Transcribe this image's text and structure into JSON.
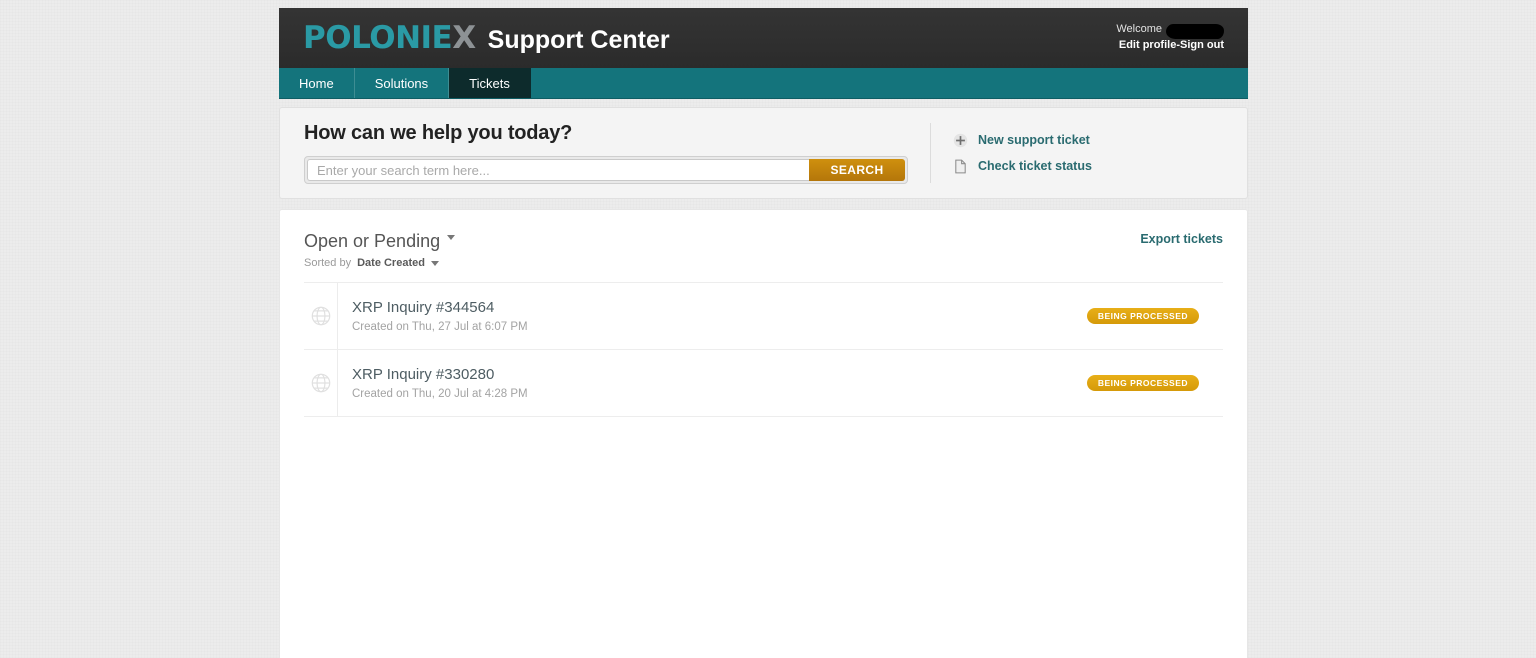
{
  "header": {
    "logo_main": "POLONIE",
    "logo_x": "X",
    "site_title": "Support Center",
    "welcome_label": "Welcome",
    "edit_profile": "Edit profile",
    "separator": "-",
    "sign_out": "Sign out",
    "brand_color": "#2a9aa5",
    "logo_x_color": "#8d9295",
    "bar_color": "#2e2e2e"
  },
  "nav": {
    "items": [
      {
        "label": "Home",
        "active": false
      },
      {
        "label": "Solutions",
        "active": false
      },
      {
        "label": "Tickets",
        "active": true
      }
    ],
    "bar_color": "#14747c",
    "active_color": "#0d2b2c"
  },
  "search": {
    "heading": "How can we help you today?",
    "placeholder": "Enter your search term here...",
    "value": "",
    "button_label": "SEARCH",
    "button_color": "#c2830c"
  },
  "quick_links": [
    {
      "label": "New support ticket",
      "icon": "plus-circle-icon"
    },
    {
      "label": "Check ticket status",
      "icon": "document-icon"
    }
  ],
  "ticket_list": {
    "filter_label": "Open or Pending",
    "sorted_by_prefix": "Sorted by",
    "sorted_by_value": "Date Created",
    "export_label": "Export tickets",
    "link_color": "#2a6b70",
    "tickets": [
      {
        "subject": "XRP Inquiry #344564",
        "created": "Created on Thu, 27 Jul at 6:07 PM",
        "status": "BEING PROCESSED",
        "status_color": "#d9a310",
        "icon": "globe-icon"
      },
      {
        "subject": "XRP Inquiry #330280",
        "created": "Created on Thu, 20 Jul at 4:28 PM",
        "status": "BEING PROCESSED",
        "status_color": "#d9a310",
        "icon": "globe-icon"
      }
    ]
  }
}
